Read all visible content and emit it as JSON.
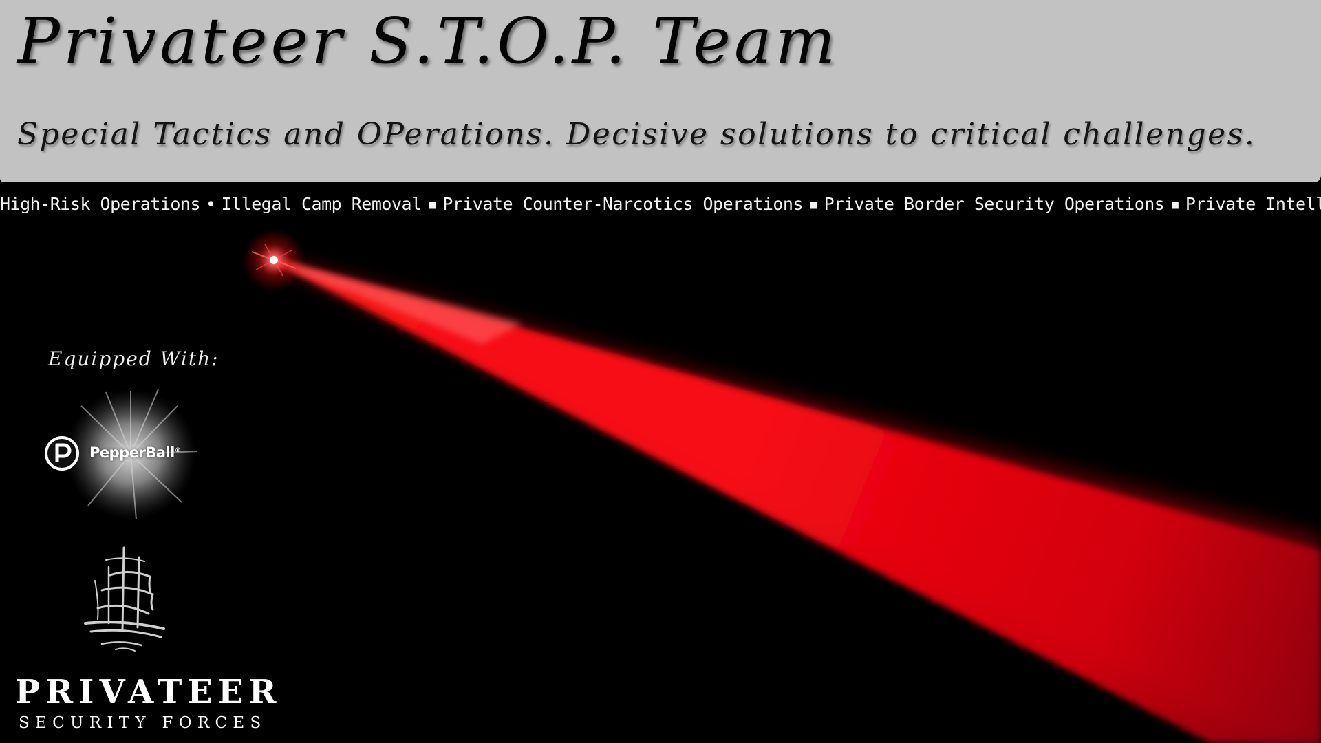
{
  "header": {
    "title": "Privateer S.T.O.P. Team",
    "tagline": "Special Tactics and OPerations. Decisive solutions to critical challenges."
  },
  "services": {
    "items": [
      "High-Risk Operations",
      "Illegal Camp Removal",
      "Private Counter-Narcotics Operations",
      "Private Border Security Operations",
      "Private Intelligence"
    ],
    "separators": [
      "•",
      "▪",
      "▪",
      "▪"
    ]
  },
  "equipment": {
    "label": "Equipped With:",
    "partner_logo_text": "PepperBall",
    "partner_logo_mark": "®",
    "partner_icon": "pepperball-p-icon"
  },
  "brand": {
    "name": "PRIVATEER",
    "subtitle": "SECURITY FORCES",
    "emblem_icon": "sailing-ship-icon"
  },
  "colors": {
    "header_background": "#c2c2c2",
    "page_background": "#000000",
    "laser_red": "#ff0a14"
  }
}
